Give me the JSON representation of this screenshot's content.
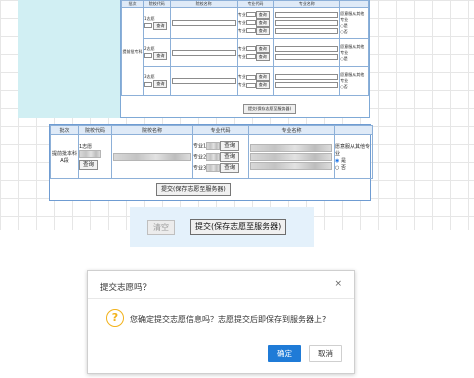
{
  "panel1": {
    "headers": [
      "批次",
      "院校代码",
      "院校名称",
      "专业代码",
      "专业名称",
      ""
    ],
    "batch": "提前批专科",
    "choices": [
      {
        "label": "1志愿",
        "query": "查询"
      },
      {
        "label": "2志愿",
        "query": "查询"
      },
      {
        "label": "3志愿",
        "query": "查询"
      }
    ],
    "major_label": "专业",
    "major_query": "查询",
    "adjust": {
      "text": "愿意服从其他专业",
      "yes": "是",
      "no": "否"
    },
    "submit": "提交(保存志愿至服务器)"
  },
  "panel2": {
    "headers": [
      "批次",
      "院校代码",
      "院校名称",
      "专业代码",
      "专业名称",
      ""
    ],
    "batch": "提前批本科A段",
    "choice_label": "1志愿",
    "query": "查询",
    "majors": [
      {
        "label": "专业1",
        "query": "查询"
      },
      {
        "label": "专业2",
        "query": "查询"
      },
      {
        "label": "专业3",
        "query": "查询"
      }
    ],
    "adjust": {
      "text": "愿意服从其他专业",
      "yes": "是",
      "no": "否"
    },
    "submit": "提交(保存志愿至服务器)"
  },
  "panel3": {
    "clear": "清空",
    "submit": "提交(保存志愿至服务器)"
  },
  "dialog": {
    "title": "提交志愿吗？",
    "close": "×",
    "icon": "question-icon",
    "message": "您确定提交志愿信息吗？志愿提交后即保存到服务器上?",
    "ok": "确定",
    "cancel": "取消",
    "ok_color": "#1f7bd7",
    "icon_color": "#f2b21b"
  }
}
